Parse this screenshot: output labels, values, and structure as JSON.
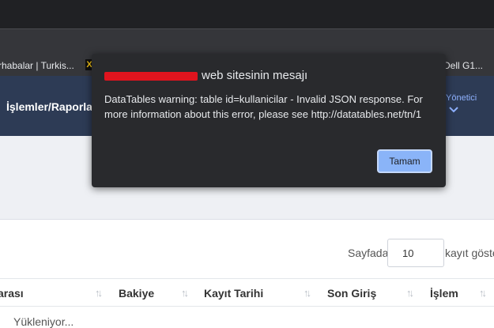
{
  "browser": {
    "bookmarks": [
      {
        "label": "rhabalar | Turkis..."
      },
      {
        "label": "Dell G1..."
      }
    ],
    "bookmark_icon_letter": "X"
  },
  "navbar": {
    "menu_label": "İşlemler/Raporlar",
    "user_label": "Yönetici",
    "accent_color": "#2d3b55"
  },
  "datatable": {
    "length": {
      "prefix": "Sayfada",
      "value": "10",
      "suffix": "kayıt göste"
    },
    "columns": [
      {
        "label": "arası"
      },
      {
        "label": "Bakiye"
      },
      {
        "label": "Kayıt Tarihi"
      },
      {
        "label": "Son Giriş"
      },
      {
        "label": "İşlem"
      }
    ],
    "loading_text": "Yükleniyor..."
  },
  "dialog": {
    "title_suffix": "web sitesinin mesajı",
    "message": "DataTables warning: table id=kullanicilar - Invalid JSON response. For more information about this error, please see http://datatables.net/tn/1",
    "ok_label": "Tamam",
    "redaction_color": "#e0141e"
  }
}
